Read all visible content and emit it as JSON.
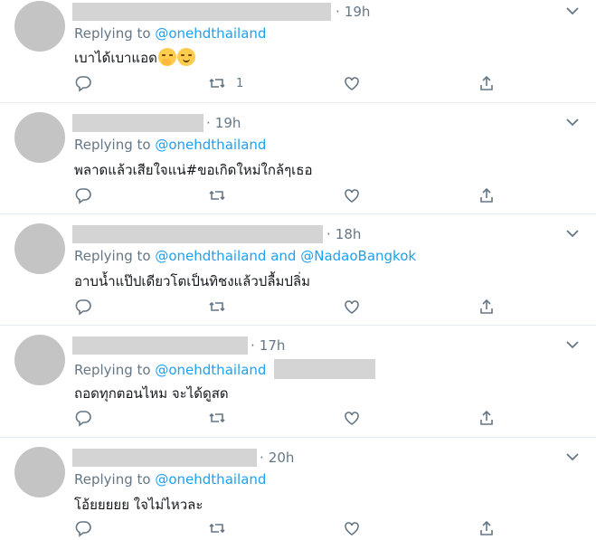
{
  "tweets": [
    {
      "time": "19h",
      "reply_prefix": "Replying to",
      "mentions": [
        "@onehdthailand"
      ],
      "connector": "",
      "text": "เบาได้เบาแอด",
      "emojis": [
        "face-with-hand-over-mouth-emoji",
        "relieved-face-emoji"
      ],
      "retweets": "1"
    },
    {
      "time": "19h",
      "reply_prefix": "Replying to",
      "mentions": [
        "@onehdthailand"
      ],
      "connector": "",
      "text": "พลาดแล้วเสียใจแน่#ขอเกิดใหม่ใกล้ๆเธอ",
      "emojis": [],
      "retweets": ""
    },
    {
      "time": "18h",
      "reply_prefix": "Replying to",
      "mentions": [
        "@onehdthailand",
        "@NadaoBangkok"
      ],
      "connector": "and",
      "text": "อาบน้ำแป๊ปเดียวโตเป็นทิชงแล้วปลื้มปลิ่ม",
      "emojis": [],
      "retweets": ""
    },
    {
      "time": "17h",
      "reply_prefix": "Replying to",
      "mentions": [
        "@onehdthailand"
      ],
      "connector": "",
      "text": "ถอดทุกตอนไหม จะได้ดูสด",
      "emojis": [],
      "retweets": ""
    },
    {
      "time": "20h",
      "reply_prefix": "Replying to",
      "mentions": [
        "@onehdthailand"
      ],
      "connector": "",
      "text": "โอ้ยยยยย ใจไม่ไหวละ",
      "emojis": [],
      "retweets": ""
    }
  ],
  "colors": {
    "mention": "#1da1f2",
    "secondary_text": "#657786",
    "primary_text": "#14171a",
    "divider": "#e6ecf0",
    "redaction": "#d4d4d4"
  }
}
